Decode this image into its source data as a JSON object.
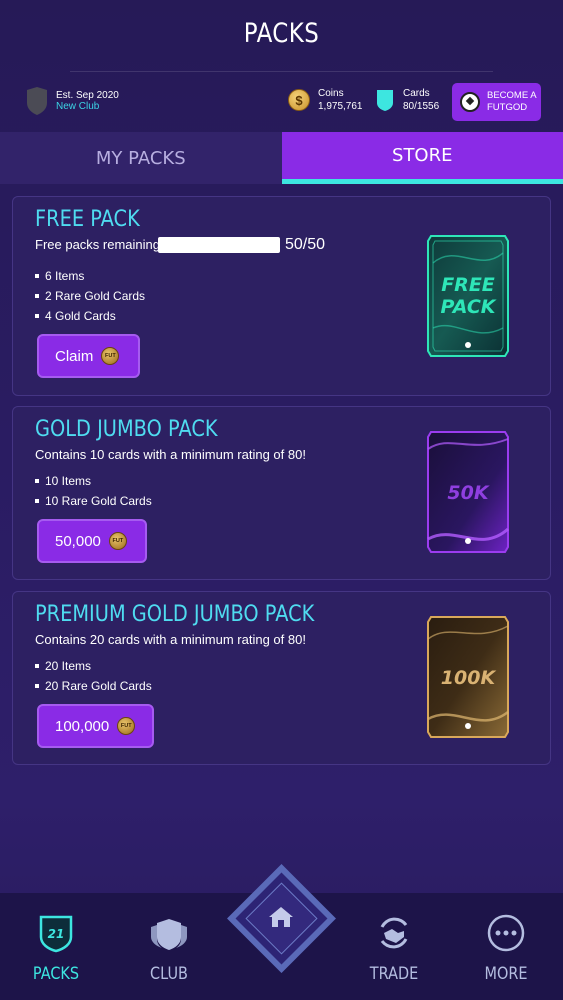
{
  "header": {
    "title": "PACKS",
    "club": {
      "est": "Est. Sep 2020",
      "name": "New Club"
    },
    "coins": {
      "label": "Coins",
      "value": "1,975,761",
      "icon": "dollar-coin-icon"
    },
    "cards": {
      "label": "Cards",
      "value": "80/1556",
      "icon": "card-icon"
    },
    "futgod_button": {
      "line1": "BECOME A",
      "line2": "FUTGOD"
    }
  },
  "tabs": {
    "my_packs": "MY PACKS",
    "store": "STORE",
    "active": "STORE"
  },
  "packs": [
    {
      "name": "FREE PACK",
      "remaining_label": "Free packs remaining:",
      "remaining_value": "50/50",
      "remaining_fraction": 1.0,
      "items": [
        "6 Items",
        "2 Rare Gold Cards",
        "4 Gold Cards"
      ],
      "button_label": "Claim",
      "art_text_1": "FREE",
      "art_text_2": "PACK",
      "art_color": "#2ee6b8"
    },
    {
      "name": "GOLD JUMBO PACK",
      "description": "Contains 10 cards with a minimum rating of 80!",
      "items": [
        "10 Items",
        "10 Rare Gold Cards"
      ],
      "button_label": "50,000",
      "art_text_1": "50K",
      "art_color": "#9b3cf0"
    },
    {
      "name": "PREMIUM GOLD JUMBO PACK",
      "description": "Contains 20 cards with a minimum rating of 80!",
      "items": [
        "20 Items",
        "20 Rare Gold Cards"
      ],
      "button_label": "100,000",
      "art_text_1": "100K",
      "art_color": "#d9a85a"
    }
  ],
  "coin_label": "FUT",
  "bottom_nav": {
    "packs": {
      "label": "PACKS",
      "badge": "21"
    },
    "club": {
      "label": "CLUB"
    },
    "home": {
      "icon": "home-icon"
    },
    "trade": {
      "label": "TRADE"
    },
    "more": {
      "label": "MORE"
    }
  },
  "colors": {
    "accent": "#8a2be6",
    "cyan": "#3de6e0",
    "pack_title": "#4fdcf0"
  }
}
